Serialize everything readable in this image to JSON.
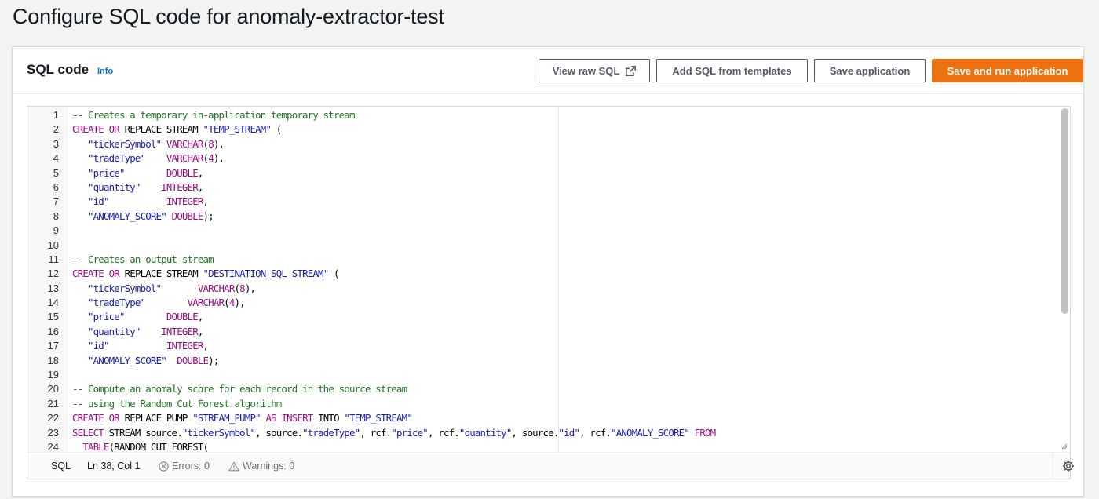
{
  "page": {
    "title": "Configure SQL code for anomaly-extractor-test"
  },
  "panel": {
    "title": "SQL code",
    "info_label": "Info",
    "buttons": {
      "view_raw": "View raw SQL",
      "add_templates": "Add SQL from templates",
      "save": "Save application",
      "save_run": "Save and run application"
    }
  },
  "colors": {
    "accent": "#ec7211",
    "link": "#0073bb",
    "comment": "#236e24",
    "keyword": "#930f80",
    "string": "#1a1aa6"
  },
  "editor": {
    "lines": [
      {
        "n": "1",
        "tokens": [
          {
            "t": "cm",
            "v": "-- Creates a temporary in-application temporary stream"
          }
        ]
      },
      {
        "n": "2",
        "tokens": [
          {
            "t": "kw",
            "v": "CREATE"
          },
          {
            "t": "pl",
            "v": " "
          },
          {
            "t": "kw",
            "v": "OR"
          },
          {
            "t": "pl",
            "v": " REPLACE STREAM "
          },
          {
            "t": "st",
            "v": "\"TEMP_STREAM\""
          },
          {
            "t": "pl",
            "v": " ("
          }
        ]
      },
      {
        "n": "3",
        "tokens": [
          {
            "t": "pl",
            "v": "   "
          },
          {
            "t": "st",
            "v": "\"tickerSymbol\""
          },
          {
            "t": "pl",
            "v": " "
          },
          {
            "t": "kw",
            "v": "VARCHAR"
          },
          {
            "t": "pl",
            "v": "("
          },
          {
            "t": "kw",
            "v": "8"
          },
          {
            "t": "pl",
            "v": "),"
          }
        ]
      },
      {
        "n": "4",
        "tokens": [
          {
            "t": "pl",
            "v": "   "
          },
          {
            "t": "st",
            "v": "\"tradeType\""
          },
          {
            "t": "pl",
            "v": "    "
          },
          {
            "t": "kw",
            "v": "VARCHAR"
          },
          {
            "t": "pl",
            "v": "("
          },
          {
            "t": "kw",
            "v": "4"
          },
          {
            "t": "pl",
            "v": "),"
          }
        ]
      },
      {
        "n": "5",
        "tokens": [
          {
            "t": "pl",
            "v": "   "
          },
          {
            "t": "st",
            "v": "\"price\""
          },
          {
            "t": "pl",
            "v": "        "
          },
          {
            "t": "kw",
            "v": "DOUBLE"
          },
          {
            "t": "pl",
            "v": ","
          }
        ]
      },
      {
        "n": "6",
        "tokens": [
          {
            "t": "pl",
            "v": "   "
          },
          {
            "t": "st",
            "v": "\"quantity\""
          },
          {
            "t": "pl",
            "v": "    "
          },
          {
            "t": "kw",
            "v": "INTEGER"
          },
          {
            "t": "pl",
            "v": ","
          }
        ]
      },
      {
        "n": "7",
        "tokens": [
          {
            "t": "pl",
            "v": "   "
          },
          {
            "t": "st",
            "v": "\"id\""
          },
          {
            "t": "pl",
            "v": "           "
          },
          {
            "t": "kw",
            "v": "INTEGER"
          },
          {
            "t": "pl",
            "v": ","
          }
        ]
      },
      {
        "n": "8",
        "tokens": [
          {
            "t": "pl",
            "v": "   "
          },
          {
            "t": "st",
            "v": "\"ANOMALY_SCORE\""
          },
          {
            "t": "pl",
            "v": " "
          },
          {
            "t": "kw",
            "v": "DOUBLE"
          },
          {
            "t": "pl",
            "v": ");"
          }
        ]
      },
      {
        "n": "9",
        "tokens": []
      },
      {
        "n": "10",
        "tokens": []
      },
      {
        "n": "11",
        "tokens": [
          {
            "t": "cm",
            "v": "-- Creates an output stream"
          }
        ]
      },
      {
        "n": "12",
        "tokens": [
          {
            "t": "kw",
            "v": "CREATE"
          },
          {
            "t": "pl",
            "v": " "
          },
          {
            "t": "kw",
            "v": "OR"
          },
          {
            "t": "pl",
            "v": " REPLACE STREAM "
          },
          {
            "t": "st",
            "v": "\"DESTINATION_SQL_STREAM\""
          },
          {
            "t": "pl",
            "v": " ("
          }
        ]
      },
      {
        "n": "13",
        "tokens": [
          {
            "t": "pl",
            "v": "   "
          },
          {
            "t": "st",
            "v": "\"tickerSymbol\""
          },
          {
            "t": "pl",
            "v": "       "
          },
          {
            "t": "kw",
            "v": "VARCHAR"
          },
          {
            "t": "pl",
            "v": "("
          },
          {
            "t": "kw",
            "v": "8"
          },
          {
            "t": "pl",
            "v": "),"
          }
        ]
      },
      {
        "n": "14",
        "tokens": [
          {
            "t": "pl",
            "v": "   "
          },
          {
            "t": "st",
            "v": "\"tradeType\""
          },
          {
            "t": "pl",
            "v": "        "
          },
          {
            "t": "kw",
            "v": "VARCHAR"
          },
          {
            "t": "pl",
            "v": "("
          },
          {
            "t": "kw",
            "v": "4"
          },
          {
            "t": "pl",
            "v": "),"
          }
        ]
      },
      {
        "n": "15",
        "tokens": [
          {
            "t": "pl",
            "v": "   "
          },
          {
            "t": "st",
            "v": "\"price\""
          },
          {
            "t": "pl",
            "v": "        "
          },
          {
            "t": "kw",
            "v": "DOUBLE"
          },
          {
            "t": "pl",
            "v": ","
          }
        ]
      },
      {
        "n": "16",
        "tokens": [
          {
            "t": "pl",
            "v": "   "
          },
          {
            "t": "st",
            "v": "\"quantity\""
          },
          {
            "t": "pl",
            "v": "    "
          },
          {
            "t": "kw",
            "v": "INTEGER"
          },
          {
            "t": "pl",
            "v": ","
          }
        ]
      },
      {
        "n": "17",
        "tokens": [
          {
            "t": "pl",
            "v": "   "
          },
          {
            "t": "st",
            "v": "\"id\""
          },
          {
            "t": "pl",
            "v": "           "
          },
          {
            "t": "kw",
            "v": "INTEGER"
          },
          {
            "t": "pl",
            "v": ","
          }
        ]
      },
      {
        "n": "18",
        "tokens": [
          {
            "t": "pl",
            "v": "   "
          },
          {
            "t": "st",
            "v": "\"ANOMALY_SCORE\""
          },
          {
            "t": "pl",
            "v": "  "
          },
          {
            "t": "kw",
            "v": "DOUBLE"
          },
          {
            "t": "pl",
            "v": ");"
          }
        ]
      },
      {
        "n": "19",
        "tokens": []
      },
      {
        "n": "20",
        "tokens": [
          {
            "t": "cm",
            "v": "-- Compute an anomaly score for each record in the source stream"
          }
        ]
      },
      {
        "n": "21",
        "tokens": [
          {
            "t": "cm",
            "v": "-- using the Random Cut Forest algorithm"
          }
        ]
      },
      {
        "n": "22",
        "tokens": [
          {
            "t": "kw",
            "v": "CREATE"
          },
          {
            "t": "pl",
            "v": " "
          },
          {
            "t": "kw",
            "v": "OR"
          },
          {
            "t": "pl",
            "v": " REPLACE PUMP "
          },
          {
            "t": "st",
            "v": "\"STREAM_PUMP\""
          },
          {
            "t": "pl",
            "v": " "
          },
          {
            "t": "kw",
            "v": "AS"
          },
          {
            "t": "pl",
            "v": " "
          },
          {
            "t": "kw",
            "v": "INSERT"
          },
          {
            "t": "pl",
            "v": " INTO "
          },
          {
            "t": "st",
            "v": "\"TEMP_STREAM\""
          }
        ]
      },
      {
        "n": "23",
        "tokens": [
          {
            "t": "kw",
            "v": "SELECT"
          },
          {
            "t": "pl",
            "v": " STREAM source."
          },
          {
            "t": "st",
            "v": "\"tickerSymbol\""
          },
          {
            "t": "pl",
            "v": ", source."
          },
          {
            "t": "st",
            "v": "\"tradeType\""
          },
          {
            "t": "pl",
            "v": ", rcf."
          },
          {
            "t": "st",
            "v": "\"price\""
          },
          {
            "t": "pl",
            "v": ", rcf."
          },
          {
            "t": "st",
            "v": "\"quantity\""
          },
          {
            "t": "pl",
            "v": ", source."
          },
          {
            "t": "st",
            "v": "\"id\""
          },
          {
            "t": "pl",
            "v": ", rcf."
          },
          {
            "t": "st",
            "v": "\"ANOMALY_SCORE\""
          },
          {
            "t": "pl",
            "v": " "
          },
          {
            "t": "kw",
            "v": "FROM"
          }
        ]
      },
      {
        "n": "24",
        "tokens": [
          {
            "t": "pl",
            "v": "  "
          },
          {
            "t": "kw",
            "v": "TABLE"
          },
          {
            "t": "pl",
            "v": "(RANDOM_CUT_FOREST("
          }
        ]
      }
    ]
  },
  "status": {
    "language": "SQL",
    "position": "Ln 38, Col 1",
    "errors": "Errors: 0",
    "warnings": "Warnings: 0"
  }
}
